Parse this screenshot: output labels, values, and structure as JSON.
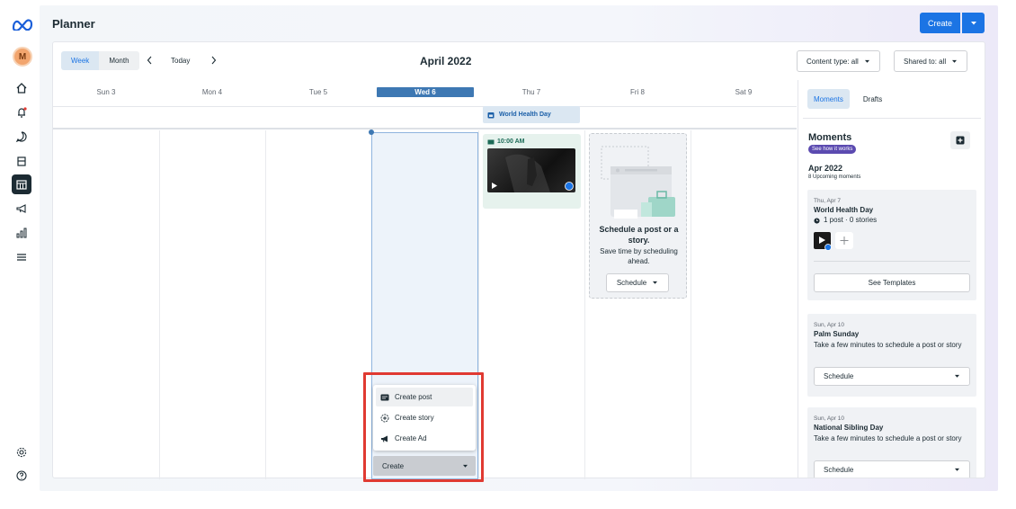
{
  "app": {
    "title": "Planner",
    "create_label": "Create"
  },
  "rail": {
    "avatar_initial": "M"
  },
  "toolbar": {
    "week_label": "Week",
    "month_label": "Month",
    "today_label": "Today",
    "current_month": "April 2022",
    "content_type_filter": "Content type: all",
    "shared_to_filter": "Shared to: all"
  },
  "calendar": {
    "days": [
      "Sun 3",
      "Mon 4",
      "Tue 5",
      "Wed 6",
      "Thu 7",
      "Fri 8",
      "Sat 9"
    ],
    "selected_day": "Wed 6",
    "allday_event": "World Health Day",
    "post_time": "10:00 AM",
    "schedule_card": {
      "title": "Schedule a post or a story.",
      "subtitle": "Save time by scheduling ahead.",
      "button": "Schedule"
    }
  },
  "create_menu": {
    "items": [
      "Create post",
      "Create story",
      "Create Ad"
    ],
    "button_label": "Create"
  },
  "right_panel": {
    "tabs": [
      "Moments",
      "Drafts"
    ],
    "heading": "Moments",
    "badge": "See how it works",
    "month": "Apr 2022",
    "upcoming_count": "8 Upcoming moments",
    "moments": [
      {
        "date": "Thu, Apr 7",
        "title": "World Health Day",
        "meta": "1 post · 0 stories",
        "button": "See Templates"
      },
      {
        "date": "Sun, Apr 10",
        "title": "Palm Sunday",
        "text": "Take a few minutes to schedule a post or story",
        "button": "Schedule"
      },
      {
        "date": "Sun, Apr 10",
        "title": "National Sibling Day",
        "text": "Take a few minutes to schedule a post or story",
        "button": "Schedule"
      }
    ]
  },
  "colors": {
    "accent": "#1b74e4",
    "highlight": "#e03a32",
    "selected_day": "#3e78b3",
    "badge": "#5b4ab0"
  }
}
